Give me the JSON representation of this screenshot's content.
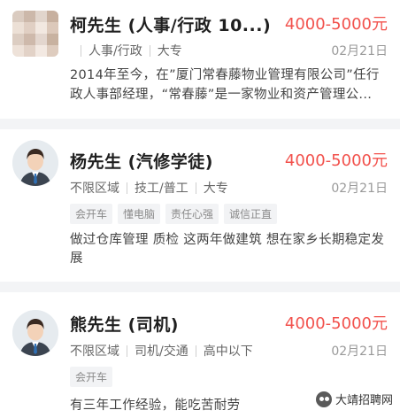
{
  "colors": {
    "salary": "#f2514c",
    "page_bg": "#f3f4f6",
    "card_bg": "#ffffff"
  },
  "cards": [
    {
      "name": "柯先生 (人事/行政 10...)",
      "salary": "4000-5000元",
      "meta": [
        "人事/行政",
        "大专"
      ],
      "date": "02月21日",
      "tags": [],
      "desc_line1": "2014年至今，在”厦门常春藤物业管理有限公司”任行",
      "desc_line2": "政人事部经理，“常春藤”是一家物业和资产管理公...",
      "avatar": "blurred-photo"
    },
    {
      "name": "杨先生 (汽修学徒)",
      "salary": "4000-5000元",
      "meta": [
        "不限区域",
        "技工/普工",
        "大专"
      ],
      "date": "02月21日",
      "tags": [
        "会开车",
        "懂电脑",
        "责任心强",
        "诚信正直"
      ],
      "desc_line1": "做过仓库管理 质检 这两年做建筑 想在家乡长期稳定发",
      "desc_line2": "展",
      "avatar": "default-person-icon"
    },
    {
      "name": "熊先生 (司机)",
      "salary": "4000-5000元",
      "meta": [
        "不限区域",
        "司机/交通",
        "高中以下"
      ],
      "date": "02月21日",
      "tags": [
        "会开车"
      ],
      "desc_line1": "有三年工作经验，能吃苦耐劳",
      "desc_line2": "",
      "avatar": "default-person-icon"
    }
  ],
  "watermark": {
    "text": "大靖招聘网"
  }
}
